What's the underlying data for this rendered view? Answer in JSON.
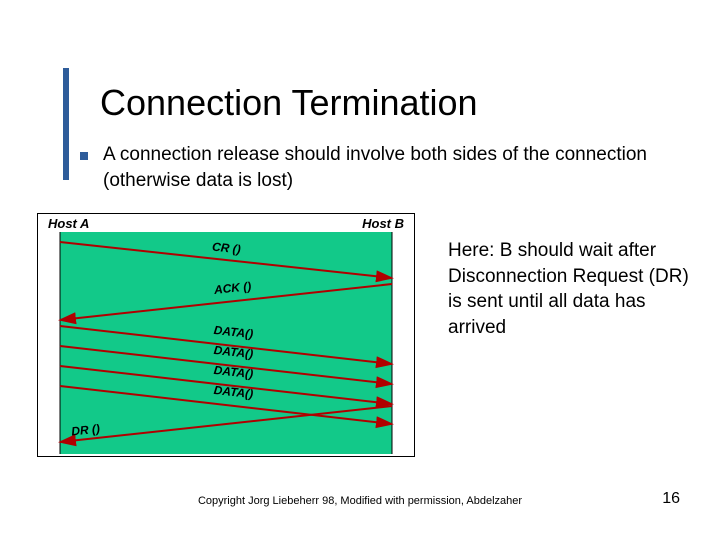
{
  "title": "Connection Termination",
  "bullet": "A connection release should involve both sides of the connection (otherwise data is lost)",
  "side_note": "Here: B should wait after Disconnection Request (DR) is sent until all data has arrived",
  "footer": "Copyright Jorg Liebeherr 98, Modified with permission, Abdelzaher",
  "page_number": "16",
  "diagram": {
    "host_a": "Host A",
    "host_b": "Host B",
    "labels": {
      "cr": "CR ()",
      "ack": "ACK ()",
      "data": "DATA()",
      "dr": "DR ()"
    }
  }
}
